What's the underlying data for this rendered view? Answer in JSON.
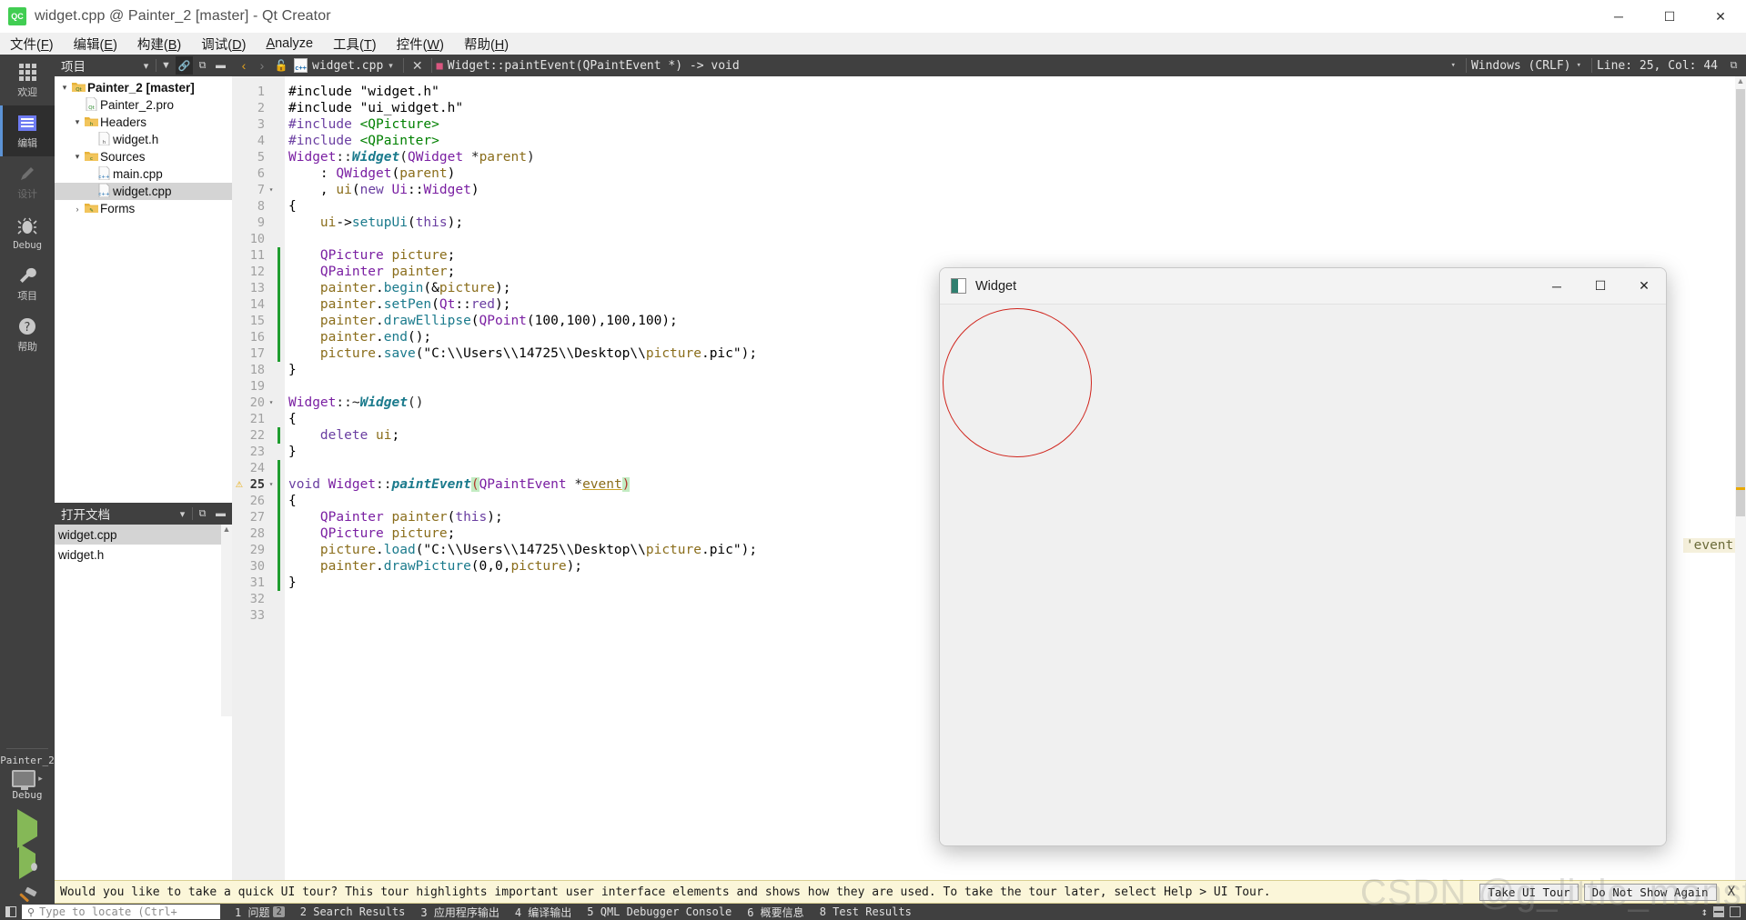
{
  "titlebar": {
    "logo_text": "QC",
    "title": "widget.cpp @ Painter_2 [master] - Qt Creator",
    "minimize": "─",
    "maximize": "☐",
    "close": "✕"
  },
  "menubar": {
    "items": [
      {
        "label": "文件(F)"
      },
      {
        "label": "编辑(E)"
      },
      {
        "label": "构建(B)"
      },
      {
        "label": "调试(D)"
      },
      {
        "label": "Analyze"
      },
      {
        "label": "工具(T)"
      },
      {
        "label": "控件(W)"
      },
      {
        "label": "帮助(H)"
      }
    ]
  },
  "modebar": {
    "modes": [
      {
        "label": "欢迎",
        "icon": "grid-icon",
        "state": "normal"
      },
      {
        "label": "编辑",
        "icon": "edit-icon",
        "state": "active"
      },
      {
        "label": "设计",
        "icon": "pencil-icon",
        "state": "dim"
      },
      {
        "label": "Debug",
        "icon": "bug-icon",
        "state": "normal"
      },
      {
        "label": "项目",
        "icon": "wrench-icon",
        "state": "normal"
      },
      {
        "label": "帮助",
        "icon": "question-icon",
        "state": "normal"
      }
    ],
    "kit_name": "Painter_2",
    "kit_mode": "Debug",
    "run_button": "run-icon",
    "debug_button": "debug-icon",
    "build_button": "hammer-icon"
  },
  "project_panel": {
    "title": "项目",
    "tools": [
      "filter-icon",
      "link-icon",
      "split-icon",
      "close-panel-icon"
    ],
    "tree": [
      {
        "label": "Painter_2 [master]",
        "icon": "qt-project-icon",
        "depth": 0,
        "arrow": "▾",
        "bold": true,
        "selected": false
      },
      {
        "label": "Painter_2.pro",
        "icon": "pro-file-icon",
        "depth": 1,
        "arrow": "",
        "bold": false,
        "selected": false
      },
      {
        "label": "Headers",
        "icon": "headers-folder-icon",
        "depth": 1,
        "arrow": "▾",
        "bold": false,
        "selected": false
      },
      {
        "label": "widget.h",
        "icon": "header-file-icon",
        "depth": 2,
        "arrow": "",
        "bold": false,
        "selected": false
      },
      {
        "label": "Sources",
        "icon": "sources-folder-icon",
        "depth": 1,
        "arrow": "▾",
        "bold": false,
        "selected": false
      },
      {
        "label": "main.cpp",
        "icon": "cpp-file-icon",
        "depth": 2,
        "arrow": "",
        "bold": false,
        "selected": false
      },
      {
        "label": "widget.cpp",
        "icon": "cpp-file-icon",
        "depth": 2,
        "arrow": "",
        "bold": false,
        "selected": true
      },
      {
        "label": "Forms",
        "icon": "forms-folder-icon",
        "depth": 1,
        "arrow": "›",
        "bold": false,
        "selected": false
      }
    ]
  },
  "open_documents": {
    "title": "打开文档",
    "items": [
      {
        "label": "widget.cpp",
        "selected": true
      },
      {
        "label": "widget.h",
        "selected": false
      }
    ]
  },
  "editor_toolbar": {
    "back_arrow": "‹",
    "forward_arrow": "›",
    "lock_icon": "unlocked-icon",
    "file_name": "widget.cpp",
    "dropdown_caret": "▾",
    "close_tab": "✕",
    "symbol_name": "Widget::paintEvent(QPaintEvent *) -> void",
    "line_ending": "Windows (CRLF)",
    "cursor_position": "Line: 25, Col: 44",
    "split_icon": "split-editor-icon"
  },
  "code": {
    "annotation_event": "'event'",
    "lines": [
      {
        "n": 1,
        "fold": "",
        "mod": false,
        "warn": false
      },
      {
        "n": 2,
        "fold": "",
        "mod": false,
        "warn": false
      },
      {
        "n": 3,
        "fold": "",
        "mod": false,
        "warn": false
      },
      {
        "n": 4,
        "fold": "",
        "mod": false,
        "warn": false
      },
      {
        "n": 5,
        "fold": "",
        "mod": false,
        "warn": false
      },
      {
        "n": 6,
        "fold": "",
        "mod": false,
        "warn": false
      },
      {
        "n": 7,
        "fold": "▾",
        "mod": false,
        "warn": false
      },
      {
        "n": 8,
        "fold": "",
        "mod": false,
        "warn": false
      },
      {
        "n": 9,
        "fold": "",
        "mod": false,
        "warn": false
      },
      {
        "n": 10,
        "fold": "",
        "mod": false,
        "warn": false
      },
      {
        "n": 11,
        "fold": "",
        "mod": true,
        "warn": false
      },
      {
        "n": 12,
        "fold": "",
        "mod": true,
        "warn": false
      },
      {
        "n": 13,
        "fold": "",
        "mod": true,
        "warn": false
      },
      {
        "n": 14,
        "fold": "",
        "mod": true,
        "warn": false
      },
      {
        "n": 15,
        "fold": "",
        "mod": true,
        "warn": false
      },
      {
        "n": 16,
        "fold": "",
        "mod": true,
        "warn": false
      },
      {
        "n": 17,
        "fold": "",
        "mod": true,
        "warn": false
      },
      {
        "n": 18,
        "fold": "",
        "mod": false,
        "warn": false
      },
      {
        "n": 19,
        "fold": "",
        "mod": false,
        "warn": false
      },
      {
        "n": 20,
        "fold": "▾",
        "mod": false,
        "warn": false
      },
      {
        "n": 21,
        "fold": "",
        "mod": false,
        "warn": false
      },
      {
        "n": 22,
        "fold": "",
        "mod": true,
        "warn": false
      },
      {
        "n": 23,
        "fold": "",
        "mod": false,
        "warn": false
      },
      {
        "n": 24,
        "fold": "",
        "mod": true,
        "warn": false
      },
      {
        "n": 25,
        "fold": "▾",
        "mod": true,
        "warn": true
      },
      {
        "n": 26,
        "fold": "",
        "mod": true,
        "warn": false
      },
      {
        "n": 27,
        "fold": "",
        "mod": true,
        "warn": false
      },
      {
        "n": 28,
        "fold": "",
        "mod": true,
        "warn": false
      },
      {
        "n": 29,
        "fold": "",
        "mod": true,
        "warn": false
      },
      {
        "n": 30,
        "fold": "",
        "mod": true,
        "warn": false
      },
      {
        "n": 31,
        "fold": "",
        "mod": true,
        "warn": false
      },
      {
        "n": 32,
        "fold": "",
        "mod": false,
        "warn": false
      },
      {
        "n": 33,
        "fold": "",
        "mod": false,
        "warn": false
      }
    ],
    "text": [
      "#include \"widget.h\"",
      "#include \"ui_widget.h\"",
      "#include <QPicture>",
      "#include <QPainter>",
      "Widget::Widget(QWidget *parent)",
      "    : QWidget(parent)",
      "    , ui(new Ui::Widget)",
      "{",
      "    ui->setupUi(this);",
      "",
      "    QPicture picture;",
      "    QPainter painter;",
      "    painter.begin(&picture);",
      "    painter.setPen(Qt::red);",
      "    painter.drawEllipse(QPoint(100,100),100,100);",
      "    painter.end();",
      "    picture.save(\"C:\\\\Users\\\\14725\\\\Desktop\\\\picture.pic\");",
      "}",
      "",
      "Widget::~Widget()",
      "{",
      "    delete ui;",
      "}",
      "",
      "void Widget::paintEvent(QPaintEvent *event)",
      "{",
      "    QPainter painter(this);",
      "    QPicture picture;",
      "    picture.load(\"C:\\\\Users\\\\14725\\\\Desktop\\\\picture.pic\");",
      "    painter.drawPicture(0,0,picture);",
      "}",
      "",
      ""
    ]
  },
  "widget_window": {
    "title": "Widget",
    "minimize": "─",
    "maximize": "☐",
    "close": "✕",
    "drawing": "red-ellipse",
    "ellipse_color": "#d0241c"
  },
  "tour": {
    "message": "Would you like to take a quick UI tour? This tour highlights important user interface elements and shows how they are used. To take the tour later, select Help > UI Tour.",
    "take_tour": "Take UI Tour",
    "do_not_show": "Do Not Show Again",
    "close": "X"
  },
  "statusbar": {
    "toggle_icon": "toggle-sidebar-icon",
    "locator_placeholder": "Type to locate (Ctrl+",
    "search_icon": "search-icon",
    "items": [
      {
        "label": "1 问题",
        "badge": "2"
      },
      {
        "label": "2 Search Results",
        "badge": ""
      },
      {
        "label": "3 应用程序输出",
        "badge": ""
      },
      {
        "label": "4 编译输出",
        "badge": ""
      },
      {
        "label": "5 QML Debugger Console",
        "badge": ""
      },
      {
        "label": "6 概要信息",
        "badge": ""
      },
      {
        "label": "8 Test Results",
        "badge": ""
      }
    ],
    "updown": "↕"
  },
  "watermark": {
    "text": "CSDN @g_little_monster"
  }
}
